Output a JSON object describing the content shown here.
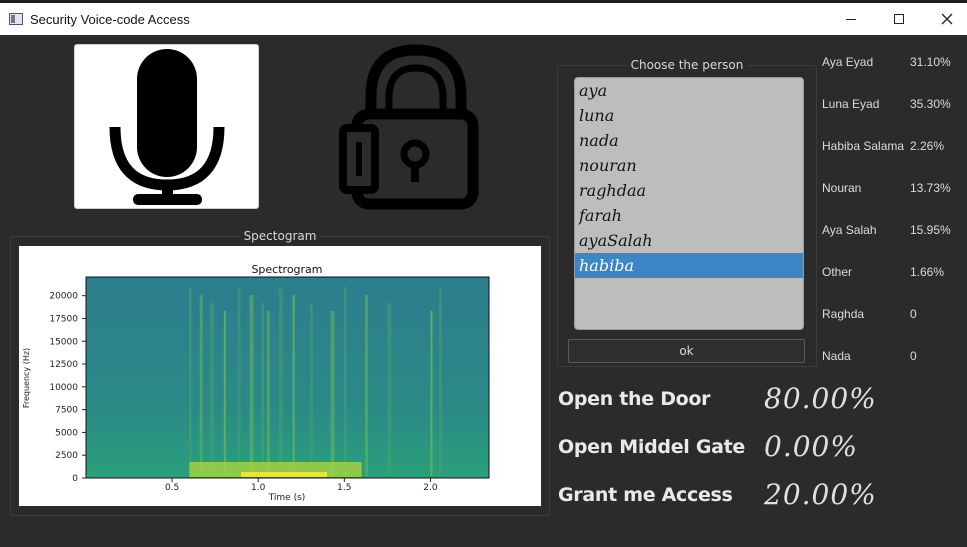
{
  "window": {
    "title": "Security Voice-code Access",
    "controls": {
      "minimize": "—",
      "maximize": "☐",
      "close": "✕"
    }
  },
  "icons": {
    "record": "microphone-icon",
    "status": "lock-icon"
  },
  "spectrogram_group": {
    "title": "Spectogram"
  },
  "spectrogram_plot": {
    "title": "Spectrogram",
    "ylabel": "Frequency (Hz)",
    "xlabel": "Time (s)",
    "yticks": [
      "0",
      "2500",
      "5000",
      "7500",
      "10000",
      "12500",
      "15000",
      "17500",
      "20000"
    ],
    "xticks": [
      "0.5",
      "1.0",
      "1.5",
      "2.0"
    ]
  },
  "person_group": {
    "title": "Choose the person",
    "items": [
      {
        "label": "aya",
        "selected": false
      },
      {
        "label": "luna",
        "selected": false
      },
      {
        "label": "nada",
        "selected": false
      },
      {
        "label": "nouran",
        "selected": false
      },
      {
        "label": "raghdaa",
        "selected": false
      },
      {
        "label": "farah",
        "selected": false
      },
      {
        "label": "ayaSalah",
        "selected": false
      },
      {
        "label": "habiba",
        "selected": true
      }
    ],
    "ok_label": "ok"
  },
  "scores": [
    {
      "name": "Aya Eyad",
      "value": "31.10%"
    },
    {
      "name": "Luna Eyad",
      "value": "35.30%"
    },
    {
      "name": "Habiba Salama",
      "value": "2.26%"
    },
    {
      "name": "Nouran",
      "value": "13.73%"
    },
    {
      "name": "Aya Salah",
      "value": "15.95%"
    },
    {
      "name": "Other",
      "value": "1.66%"
    },
    {
      "name": "Raghda",
      "value": "0"
    },
    {
      "name": "Nada",
      "value": "0"
    }
  ],
  "results": [
    {
      "label": "Open the Door",
      "value": "80.00%"
    },
    {
      "label": "Open Middel Gate",
      "value": "0.00%"
    },
    {
      "label": "Grant me Access",
      "value": "20.00%"
    }
  ],
  "colors": {
    "background": "#2b2b2b",
    "selection": "#3d86c6",
    "list_bg": "#bdbdbd"
  }
}
